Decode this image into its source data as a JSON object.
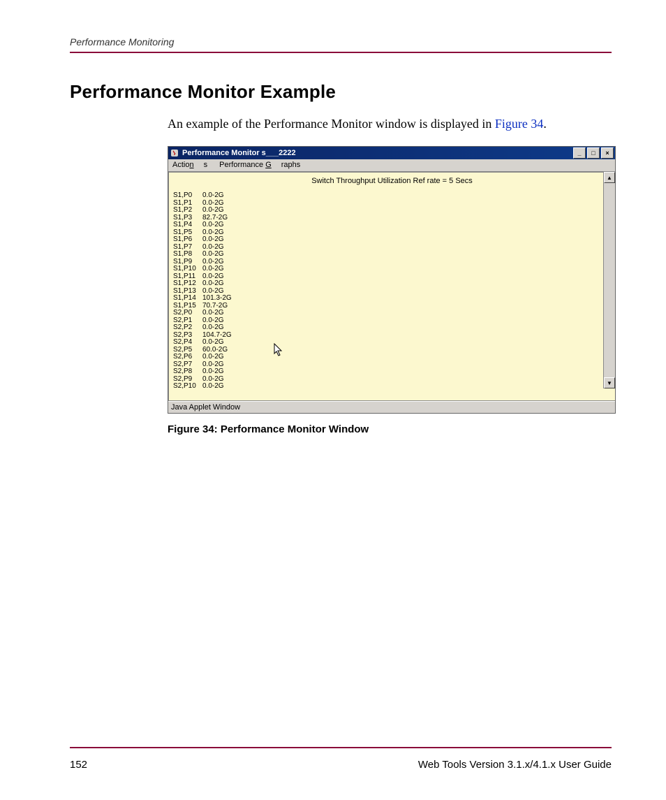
{
  "header": {
    "running": "Performance Monitoring",
    "title": "Performance Monitor Example"
  },
  "body": {
    "intro_a": "An example of the Performance Monitor window is displayed in ",
    "intro_link": "Figure 34",
    "intro_b": "."
  },
  "window": {
    "title": "Performance Monitor s___2222",
    "min": "_",
    "max": "□",
    "close": "×",
    "menu": {
      "actions": "Actions",
      "graphs": "Performance Graphs",
      "actions_u": "n",
      "graphs_u": "G"
    },
    "chart_title": "Switch Throughput Utilization Ref rate = 5 Secs",
    "status": "Java Applet Window",
    "scroll_up": "▲",
    "scroll_dn": "▼",
    "cursor": "↖",
    "ports": [
      {
        "label": "S1,P0",
        "val": "0.0-2G"
      },
      {
        "label": "S1,P1",
        "val": "0.0-2G"
      },
      {
        "label": "S1,P2",
        "val": "0.0-2G"
      },
      {
        "label": "S1,P3",
        "val": "82.7-2G"
      },
      {
        "label": "S1,P4",
        "val": "0.0-2G"
      },
      {
        "label": "S1,P5",
        "val": "0.0-2G"
      },
      {
        "label": "S1,P6",
        "val": "0.0-2G"
      },
      {
        "label": "S1,P7",
        "val": "0.0-2G"
      },
      {
        "label": "S1,P8",
        "val": "0.0-2G"
      },
      {
        "label": "S1,P9",
        "val": "0.0-2G"
      },
      {
        "label": "S1,P10",
        "val": "0.0-2G"
      },
      {
        "label": "S1,P11",
        "val": "0.0-2G"
      },
      {
        "label": "S1,P12",
        "val": "0.0-2G"
      },
      {
        "label": "S1,P13",
        "val": "0.0-2G"
      },
      {
        "label": "S1,P14",
        "val": "101.3-2G"
      },
      {
        "label": "S1,P15",
        "val": "70.7-2G"
      },
      {
        "label": "S2,P0",
        "val": "0.0-2G"
      },
      {
        "label": "S2,P1",
        "val": "0.0-2G"
      },
      {
        "label": "S2,P2",
        "val": "0.0-2G"
      },
      {
        "label": "S2,P3",
        "val": "104.7-2G"
      },
      {
        "label": "S2,P4",
        "val": "0.0-2G"
      },
      {
        "label": "S2,P5",
        "val": "60.0-2G"
      },
      {
        "label": "S2,P6",
        "val": "0.0-2G"
      },
      {
        "label": "S2,P7",
        "val": "0.0-2G"
      },
      {
        "label": "S2,P8",
        "val": "0.0-2G"
      },
      {
        "label": "S2,P9",
        "val": "0.0-2G"
      },
      {
        "label": "S2,P10",
        "val": "0.0-2G"
      }
    ]
  },
  "caption": "Figure 34:  Performance Monitor Window",
  "footer": {
    "page": "152",
    "doc": "Web Tools Version 3.1.x/4.1.x User Guide"
  }
}
